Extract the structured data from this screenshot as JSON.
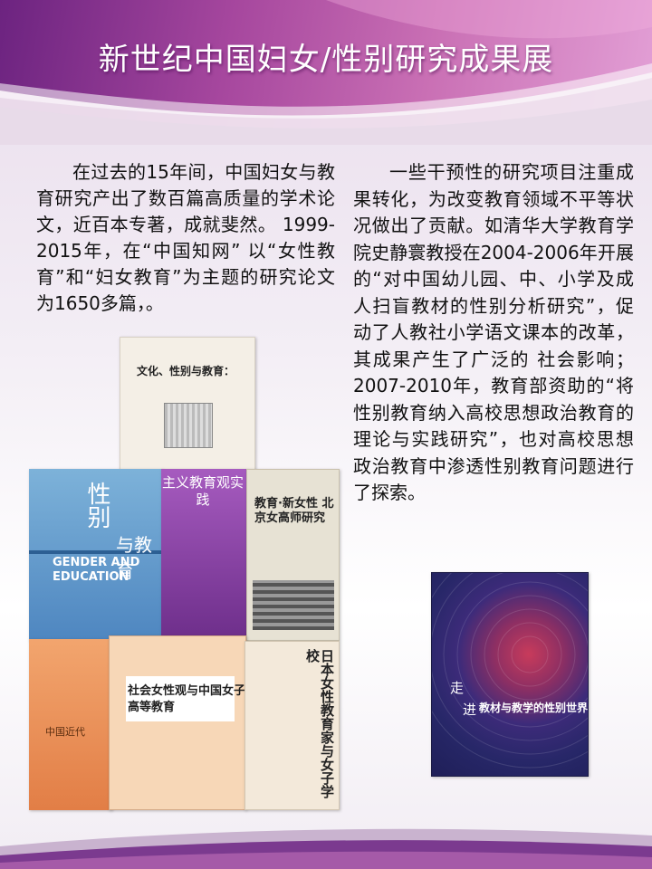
{
  "title": "新世纪中国妇女/性别研究成果展",
  "left_text": "在过去的15年间，中国妇女与教育研究产出了数百篇高质量的学术论文，近百本专著，成就斐然。 1999-2015年，在“中国知网” 以“女性教育”和“妇女教育”为主题的研究论文为1650多篇，。",
  "right_text": "一些干预性的研究项目注重成果转化，为改变教育领域不平等状况做出了贡献。如清华大学教育学院史静寰教授在2004-2006年开展的“对中国幼儿园、中、小学及成人扫盲教材的性别分析研究”，促动了人教社小学语文课本的改革，其成果产生了广泛的 社会影响；2007-2010年，教育部资助的“将性别教育纳入高校思想政治教育的理论与实践研究”，也对高校思想政治教育中渗透性别教育问题进行了探索。",
  "books": {
    "b1_title": "文化、性别与教育：",
    "b2_cn1": "性别",
    "b2_cn2": "与教育",
    "b2_en": "GENDER AND EDUCATION",
    "b3_title": "主义教育观实践",
    "b4_title": "教育·新女性 北京女高师研究",
    "b5_title": "中国近代",
    "b6_title": "社会女性观与中国女子高等教育",
    "b7_title": "日本女性教育家与女子学校",
    "b8_zou": "走",
    "b8_jin": "进",
    "b8_sub": "教材与教学的性别世界"
  },
  "colors": {
    "header_start": "#6c2380",
    "header_end": "#e3a0d6",
    "title_text": "#ffffff"
  }
}
